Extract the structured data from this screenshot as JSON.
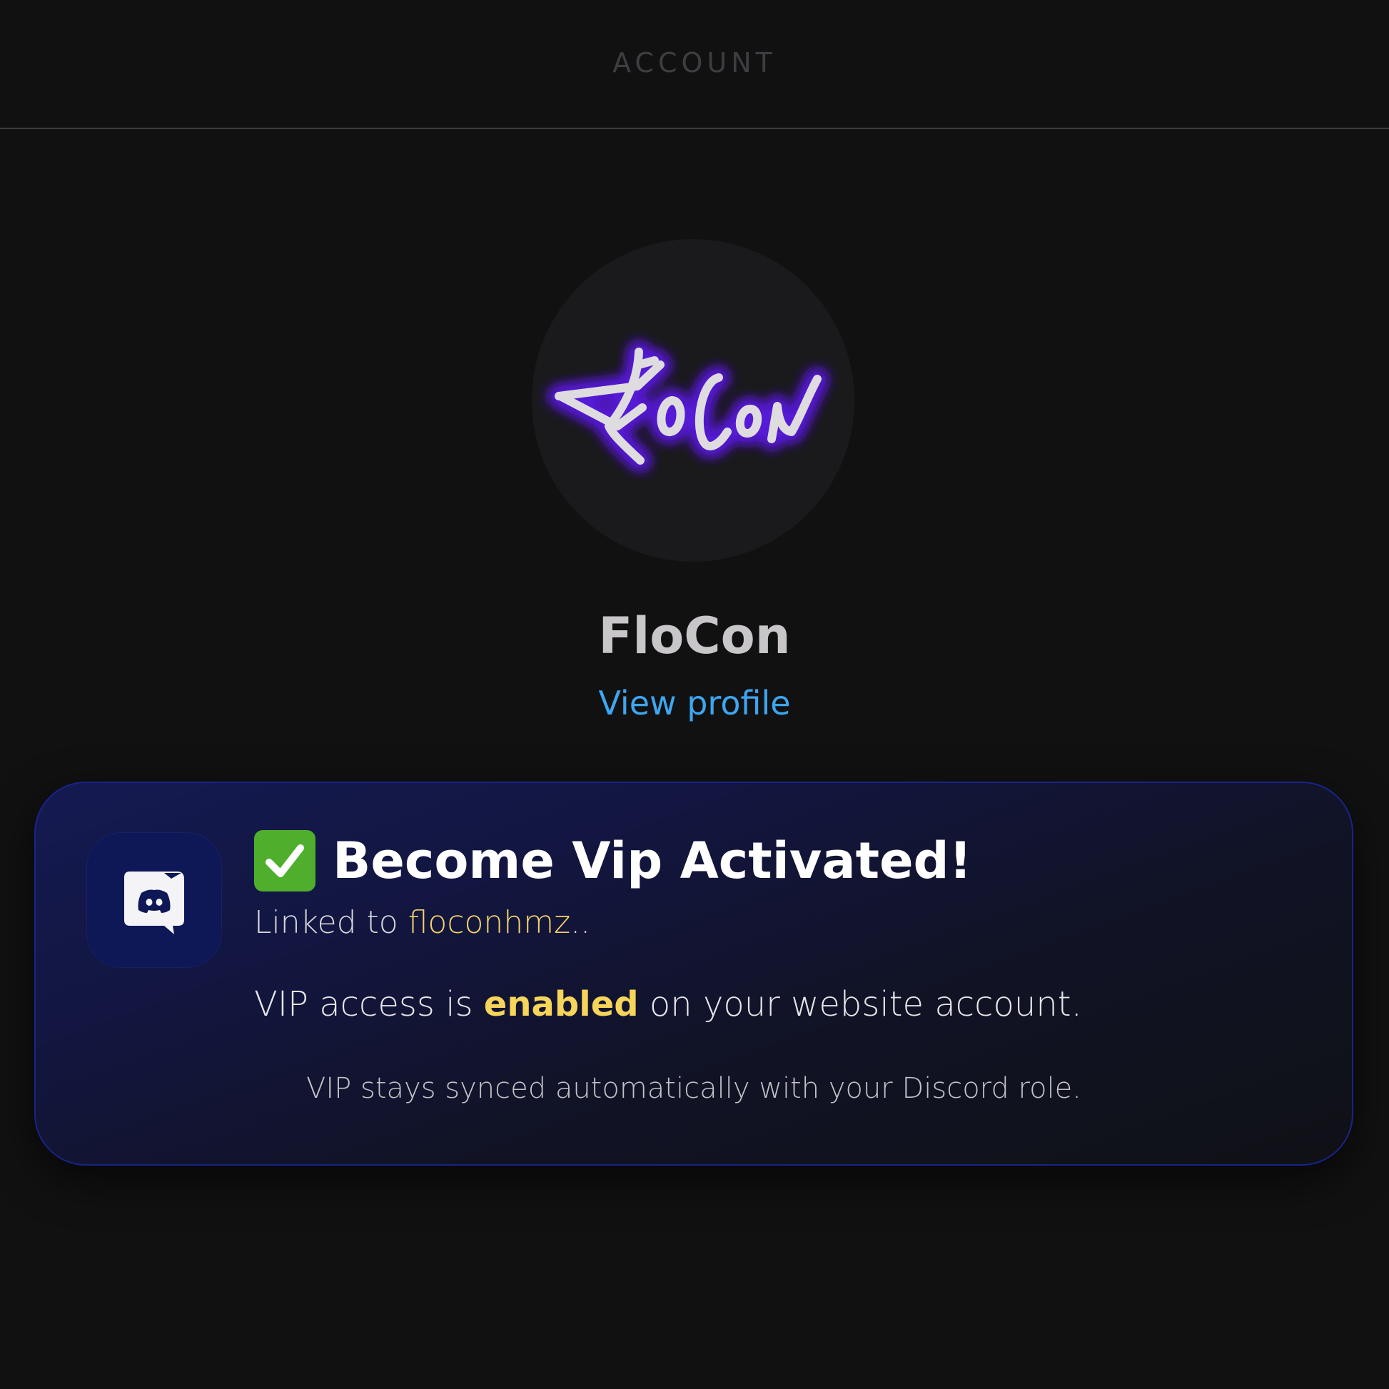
{
  "header": {
    "title": "ACCOUNT"
  },
  "profile": {
    "avatar_logo_text": "FloCon",
    "name": "FloCon",
    "view_profile_label": "View profile"
  },
  "vip_card": {
    "icon": "discord-icon",
    "status_icon": "check-mark-icon",
    "title": "Become Vip Activated!",
    "linked_prefix": "Linked to ",
    "linked_username": "floconhmz",
    "linked_suffix": "..",
    "access_prefix": "VIP access is ",
    "access_status": "enabled",
    "access_suffix": " on your website account.",
    "sync_note": "VIP stays synced automatically with your Discord role."
  },
  "colors": {
    "background": "#111112",
    "link": "#3ea6f0",
    "highlight": "#f7d45a",
    "card_border": "#19238a",
    "check_green": "#4fae2c",
    "logo_glow": "#6a2cff"
  }
}
